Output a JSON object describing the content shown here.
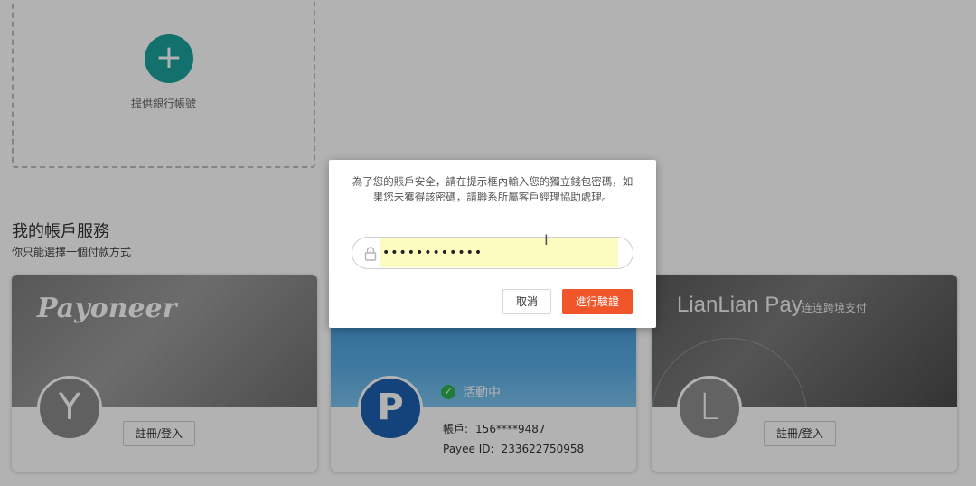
{
  "add_bank": {
    "label": "提供銀行帳號"
  },
  "section": {
    "title": "我的帳戶服務",
    "subtitle": "你只能選擇一個付款方式"
  },
  "cards": [
    {
      "brand": "Payoneer",
      "avatar_letter": "Y",
      "register_label": "註冊/登入"
    },
    {
      "avatar_letter": "P",
      "status": "活動中",
      "account_label": "帳戶:",
      "account_value": "156****9487",
      "payee_label": "Payee ID:",
      "payee_value": "233622750958"
    },
    {
      "brand": "LianLian Pay",
      "brand_sub": "连连跨境支付",
      "avatar_letter": "L",
      "register_label": "註冊/登入"
    }
  ],
  "modal": {
    "message": "為了您的賬戶安全，請在提示框內輸入您的獨立錢包密碼，如果您未獲得該密碼，請聯系所屬客戶經理協助處理。",
    "password_value": "••••••••••••",
    "cancel_label": "取消",
    "verify_label": "進行驗證"
  },
  "colors": {
    "accent": "#1ba39c",
    "primary_button": "#f0562a",
    "autofill": "#fcfcc0"
  },
  "icons": [
    "plus-icon",
    "check-circle-icon",
    "lock-icon",
    "text-cursor-icon"
  ]
}
